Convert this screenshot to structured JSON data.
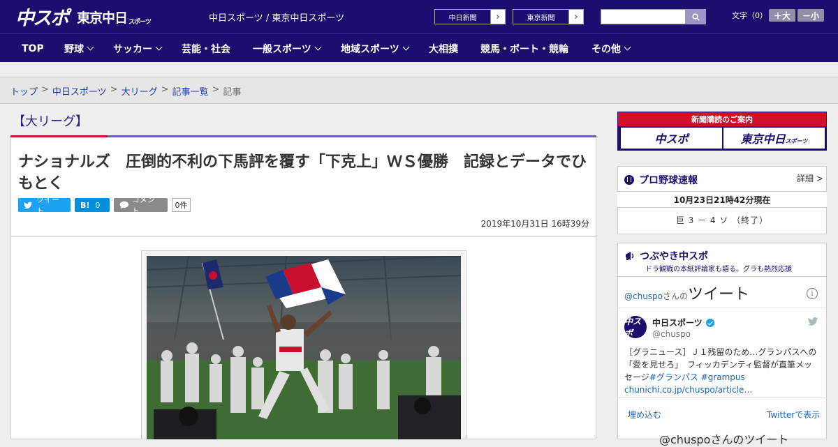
{
  "header": {
    "logo_chuspo": "中スポ",
    "logo_tokyo": "東京中日",
    "logo_tokyo_small": "スポーツ",
    "site_title": "中日スポーツ / 東京中日スポーツ",
    "paper_links": [
      {
        "label": "中日新聞"
      },
      {
        "label": "東京新聞"
      }
    ],
    "search_placeholder": "",
    "font_size_label": "文字（0）",
    "font_plus": "＋大",
    "font_minus": "－小"
  },
  "nav": {
    "items": [
      {
        "label": "TOP",
        "has_menu": false
      },
      {
        "label": "野球",
        "has_menu": true
      },
      {
        "label": "サッカー",
        "has_menu": true
      },
      {
        "label": "芸能・社会",
        "has_menu": false
      },
      {
        "label": "一般スポーツ",
        "has_menu": true
      },
      {
        "label": "地域スポーツ",
        "has_menu": true
      },
      {
        "label": "大相撲",
        "has_menu": false
      },
      {
        "label": "競馬・ボート・競輪",
        "has_menu": false
      },
      {
        "label": "その他",
        "has_menu": true
      }
    ]
  },
  "breadcrumb": {
    "items": [
      "トップ",
      "中日スポーツ",
      "大リーグ",
      "記事一覧"
    ],
    "current": "記事",
    "separator": ">"
  },
  "article": {
    "category": "【大リーグ】",
    "headline": "ナショナルズ　圧倒的不利の下馬評を覆す「下克上」ＷＳ優勝　記録とデータでひもとく",
    "tweet_label": "ツイート",
    "hatena_label": "B!",
    "hatena_count": "0",
    "comment_label": "コメント",
    "comment_count": "0件",
    "date": "2019年10月31日 16時39分"
  },
  "sidebar": {
    "subscribe_title": "新聞購読のご案内",
    "subscribe_chuspo": "中スポ",
    "subscribe_tokyo": "東京中日",
    "subscribe_tokyo_small": "スポーツ",
    "baseball_title": "プロ野球速報",
    "baseball_detail": "詳細 >",
    "baseball_time": "10月23日21時42分現在",
    "baseball_score": "巨 3 － 4 ソ （終了）",
    "tweet_section_title": "つぶやき中スポ",
    "tweet_section_sub": "ドラ観戦の本紙評論家も語る。グラも熱烈応援",
    "tweet_widget": {
      "handle": "@chuspo",
      "handle_suffix": "さんの",
      "heading": "ツイート",
      "name": "中日スポーツ",
      "at": "@chuspo",
      "avatar_text": "中スポ",
      "text_line": "［グラニュース］Ｊ１残留のため…グランパスへの「愛を見せろ」　フィッカデンティ監督が直筆メッセージ",
      "tag1": "#グランパス",
      "tag2": "#grampus",
      "link": "chunichi.co.jp/chuspo/article…",
      "embed": "埋め込む",
      "view_on_twitter": "Twitterで表示",
      "bottom_text": "@chuspoさんのツイート"
    }
  },
  "colors": {
    "brand_navy": "#1a0f6e",
    "accent_red": "#d0102a",
    "twitter_blue": "#1da1f2",
    "hatena_blue": "#008fde"
  }
}
